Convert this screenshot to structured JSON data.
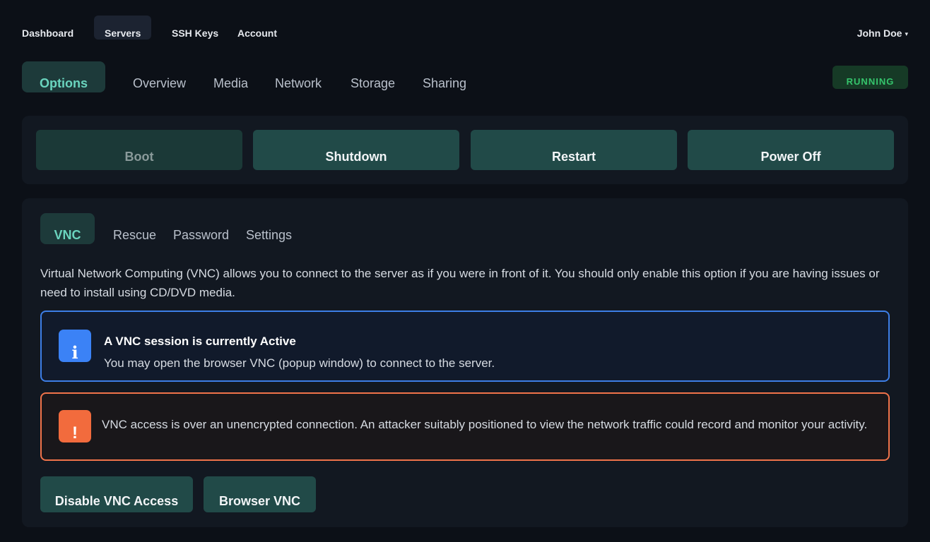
{
  "topnav": {
    "items": [
      {
        "label": "Dashboard"
      },
      {
        "label": "Servers"
      },
      {
        "label": "SSH Keys"
      },
      {
        "label": "Account"
      }
    ],
    "user": "John Doe",
    "user_caret": "▾"
  },
  "server_tabs": [
    {
      "label": "Options"
    },
    {
      "label": "Overview"
    },
    {
      "label": "Media"
    },
    {
      "label": "Network"
    },
    {
      "label": "Storage"
    },
    {
      "label": "Sharing"
    }
  ],
  "status": {
    "label": "RUNNING",
    "color": "#35c46c"
  },
  "power": {
    "boot": "Boot",
    "shutdown": "Shutdown",
    "restart": "Restart",
    "power_off": "Power Off"
  },
  "console_tabs": [
    {
      "label": "VNC"
    },
    {
      "label": "Rescue"
    },
    {
      "label": "Password"
    },
    {
      "label": "Settings"
    }
  ],
  "vnc": {
    "description": "Virtual Network Computing (VNC) allows you to connect to the server as if you were in front of it. You should only enable this option if you are having issues or need to install using CD/DVD media.",
    "info_alert": {
      "icon": "info-icon",
      "glyph": "i",
      "title": "A VNC session is currently Active",
      "body": "You may open the browser VNC (popup window) to connect to the server."
    },
    "warning_alert": {
      "icon": "exclamation-icon",
      "glyph": "!",
      "body": "VNC access is over an unencrypted connection. An attacker suitably positioned to view the network traffic could record and monitor your activity."
    },
    "disable_button": "Disable VNC Access",
    "browser_button": "Browser VNC"
  },
  "colors": {
    "background": "#0c1017",
    "panel": "#121821",
    "accent": "#6ad4be",
    "button": "#214a48",
    "info": "#3b82f6",
    "warning": "#f26b3d"
  }
}
